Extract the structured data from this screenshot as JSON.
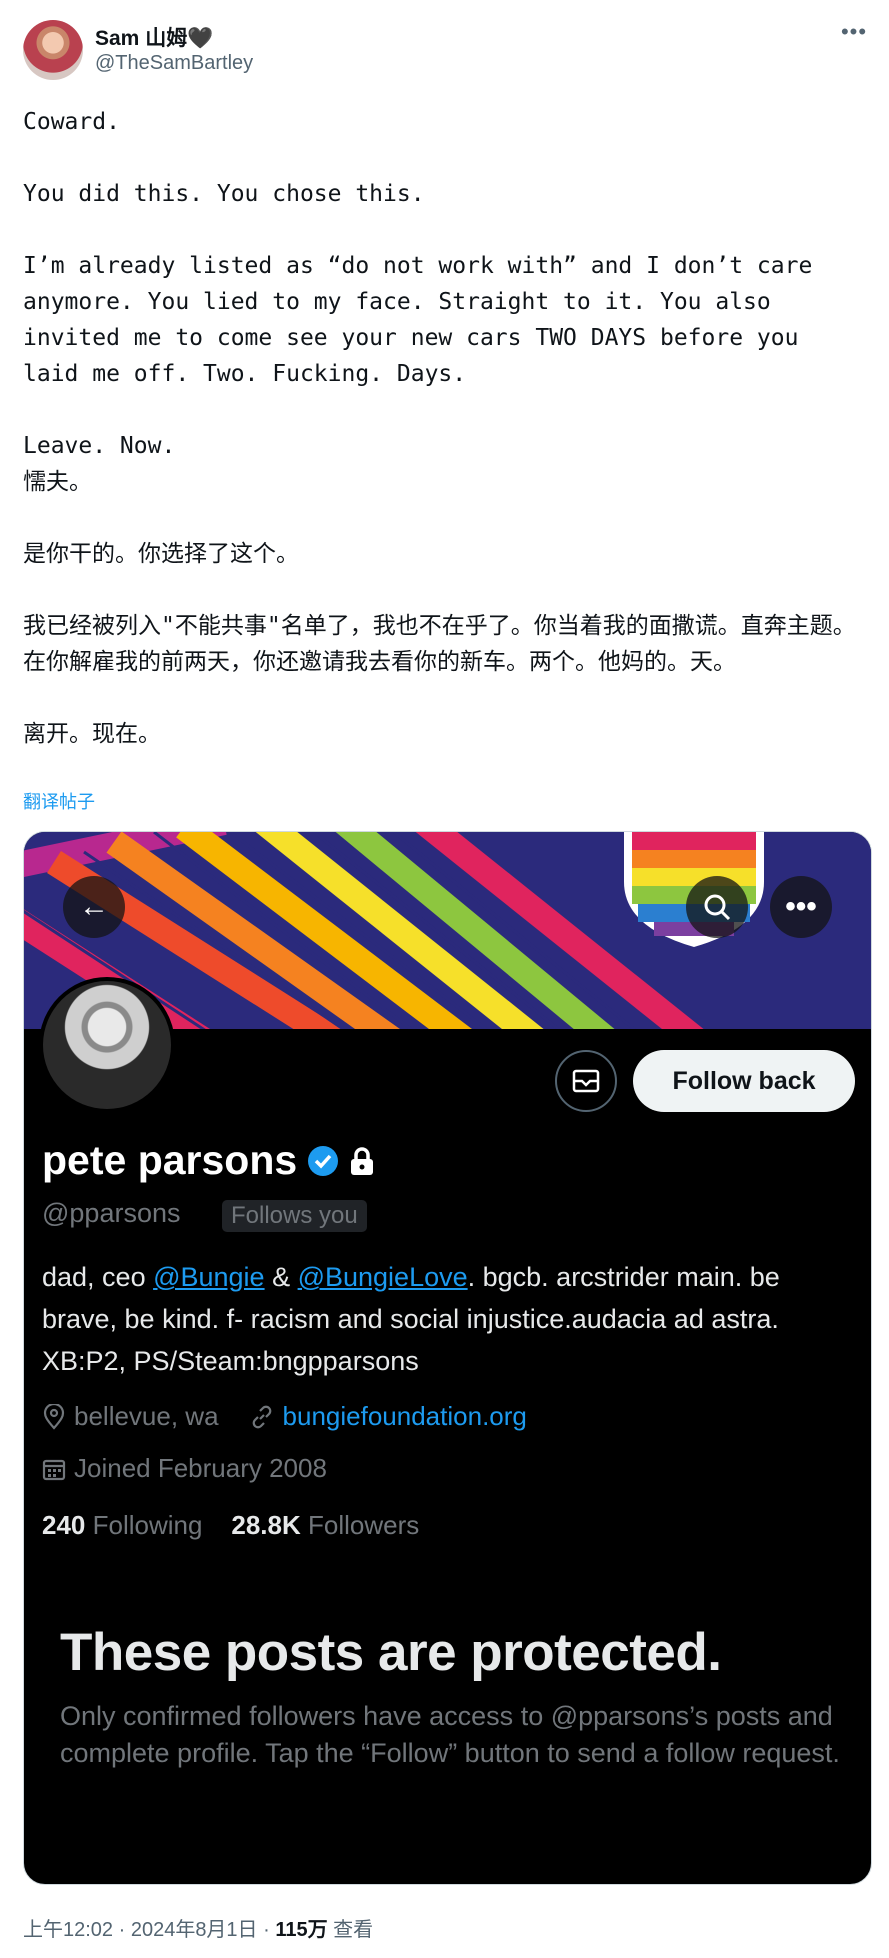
{
  "tweet": {
    "author_name": "Sam 山姆🖤",
    "author_handle": "@TheSamBartley",
    "more_icon": "more-horizontal-icon",
    "text": "Coward.\n\nYou did this. You chose this.\n\nI’m already listed as “do not work with” and I don’t care anymore. You lied to my face. Straight to it. You also invited me to come see your new cars TWO DAYS before you laid me off. Two. Fucking. Days.\n\nLeave. Now.\n懦夫。\n\n是你干的。你选择了这个。\n\n我已经被列入\"不能共事\"名单了，我也不在乎了。你当着我的面撒谎。直奔主题。在你解雇我的前两天，你还邀请我去看你的新车。两个。他妈的。天。\n\n离开。现在。",
    "translate_label": "翻译帖子"
  },
  "embedded_profile": {
    "back_icon": "arrow-left-icon",
    "search_icon": "search-icon",
    "more_icon": "more-horizontal-icon",
    "message_icon": "envelope-icon",
    "follow_back_label": "Follow back",
    "name": "pete parsons",
    "verified_icon": "verified-badge-icon",
    "lock_icon": "lock-icon",
    "handle": "@pparsons",
    "follows_you_label": "Follows you",
    "bio_part1": "dad, ceo ",
    "bio_mention1": "@Bungie",
    "bio_part2": " & ",
    "bio_mention2": "@BungieLove",
    "bio_part3": ". bgcb. arcstrider main. be brave, be kind. f- racism and social injustice.audacia ad astra. XB:P2, PS/Steam:bngpparsons",
    "location": "bellevue, wa",
    "website": "bungiefoundation.org",
    "joined": "Joined February 2008",
    "following_count": "240",
    "following_label": "Following",
    "followers_count": "28.8K",
    "followers_label": "Followers",
    "protected_title": "These posts are protected.",
    "protected_body": "Only confirmed followers have access to @pparsons’s posts and complete profile. Tap the “Follow” button to send a follow request."
  },
  "footer": {
    "time": "上午12:02 · 2024年8月1日 · ",
    "views_count": "115万",
    "views_label": " 查看"
  }
}
